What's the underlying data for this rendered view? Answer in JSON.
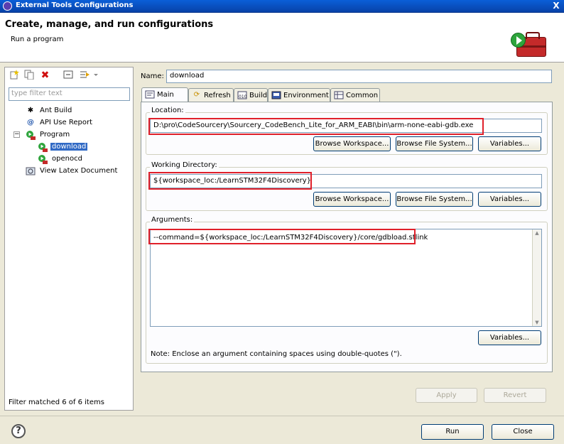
{
  "window": {
    "title": "External Tools Configurations",
    "close_glyph": "X"
  },
  "header": {
    "title": "Create, manage, and run configurations",
    "subtitle": "Run a program"
  },
  "left": {
    "filter_placeholder": "type filter text",
    "tree": [
      {
        "label": "Ant Build",
        "icon": "ant-icon"
      },
      {
        "label": "API Use Report",
        "icon": "at-icon"
      },
      {
        "label": "Program",
        "icon": "program-icon"
      },
      {
        "label": "download",
        "icon": "program-config-icon"
      },
      {
        "label": "openocd",
        "icon": "program-config-icon"
      },
      {
        "label": "View Latex Document",
        "icon": "latex-icon"
      }
    ],
    "status": "Filter matched 6 of 6 items"
  },
  "name": {
    "label": "Name:",
    "value": "download"
  },
  "tabs": [
    {
      "label": "Main",
      "icon": "main-tab-icon"
    },
    {
      "label": "Refresh",
      "icon": "refresh-tab-icon"
    },
    {
      "label": "Build",
      "icon": "build-tab-icon"
    },
    {
      "label": "Environment",
      "icon": "environment-tab-icon"
    },
    {
      "label": "Common",
      "icon": "common-tab-icon"
    }
  ],
  "location": {
    "label": "Location:",
    "value": "D:\\pro\\CodeSourcery\\Sourcery_CodeBench_Lite_for_ARM_EABI\\bin\\arm-none-eabi-gdb.exe",
    "btn_workspace": "Browse Workspace...",
    "btn_filesystem": "Browse File System...",
    "btn_variables": "Variables..."
  },
  "workdir": {
    "label": "Working Directory:",
    "value": "${workspace_loc:/LearnSTM32F4Discovery}",
    "btn_workspace": "Browse Workspace...",
    "btn_filesystem": "Browse File System...",
    "btn_variables": "Variables..."
  },
  "arguments": {
    "label": "Arguments:",
    "value": "--command=${workspace_loc:/LearnSTM32F4Discovery}/core/gdbload.stlink",
    "btn_variables": "Variables...",
    "note": "Note: Enclose an argument containing spaces using double-quotes (\")."
  },
  "actions": {
    "apply": "Apply",
    "revert": "Revert",
    "run": "Run",
    "close": "Close"
  },
  "colors": {
    "highlight_box": "#e0202a",
    "selection": "#316ac5",
    "titlebar": "#0a5fd8"
  }
}
